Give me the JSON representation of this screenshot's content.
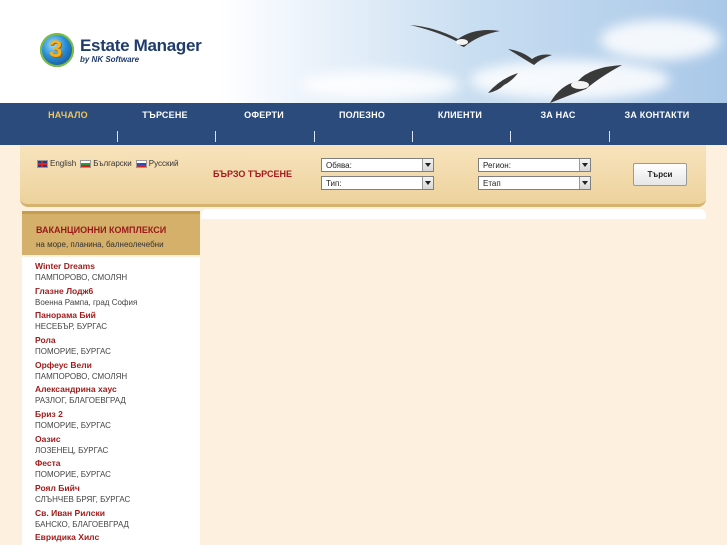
{
  "brand": {
    "title": "Estate Manager",
    "subtitle": "by NK Software",
    "logo_glyph": "3"
  },
  "nav": [
    {
      "label": "НАЧАЛО",
      "active": true
    },
    {
      "label": "ТЪРСЕНЕ"
    },
    {
      "label": "ОФЕРТИ"
    },
    {
      "label": "ПОЛЕЗНО"
    },
    {
      "label": "КЛИЕНТИ"
    },
    {
      "label": "ЗА НАС"
    },
    {
      "label": "ЗА КОНТАКТИ"
    }
  ],
  "languages": [
    {
      "label": "English",
      "flag": "en"
    },
    {
      "label": "Български",
      "flag": "bg"
    },
    {
      "label": "Русский",
      "flag": "ru"
    }
  ],
  "search": {
    "title": "БЪРЗО ТЪРСЕНЕ",
    "field_ad": "Обява:",
    "field_type": "Тип:",
    "field_region": "Регион:",
    "field_floor": "Етап",
    "button": "Търси"
  },
  "sidebar": {
    "title": "ВАКАНЦИОННИ КОМПЛЕКСИ",
    "subtitle": "на море, планина, балнеолечебни",
    "items": [
      {
        "name": "Winter Dreams",
        "location": "ПАМПОРОВО, СМОЛЯН"
      },
      {
        "name": "Глазне Лодж6",
        "location": "Военна Рампа, град София"
      },
      {
        "name": "Панорама Бий",
        "location": "НЕСЕБЪР, БУРГАС"
      },
      {
        "name": "Рола",
        "location": "ПОМОРИЕ, БУРГАС"
      },
      {
        "name": "Орфеус Вели",
        "location": "ПАМПОРОВО, СМОЛЯН"
      },
      {
        "name": "Александрина хаус",
        "location": "РАЗЛОГ, БЛАГОЕВГРАД"
      },
      {
        "name": "Бриз 2",
        "location": "ПОМОРИЕ, БУРГАС"
      },
      {
        "name": "Оазис",
        "location": "ЛОЗЕНЕЦ, БУРГАС"
      },
      {
        "name": "Феста",
        "location": "ПОМОРИЕ, БУРГАС"
      },
      {
        "name": "Роял Бийч",
        "location": "СЛЪНЧЕВ БРЯГ, БУРГАС"
      },
      {
        "name": "Св. Иван Рилски",
        "location": "БАНСКО, БЛАГОЕВГРАД"
      },
      {
        "name": "Евридика Хилс",
        "location": ""
      }
    ]
  },
  "colors": {
    "nav_bg": "#2a4b7c",
    "accent_red": "#a01c1c",
    "sand": "#d4b06a"
  }
}
